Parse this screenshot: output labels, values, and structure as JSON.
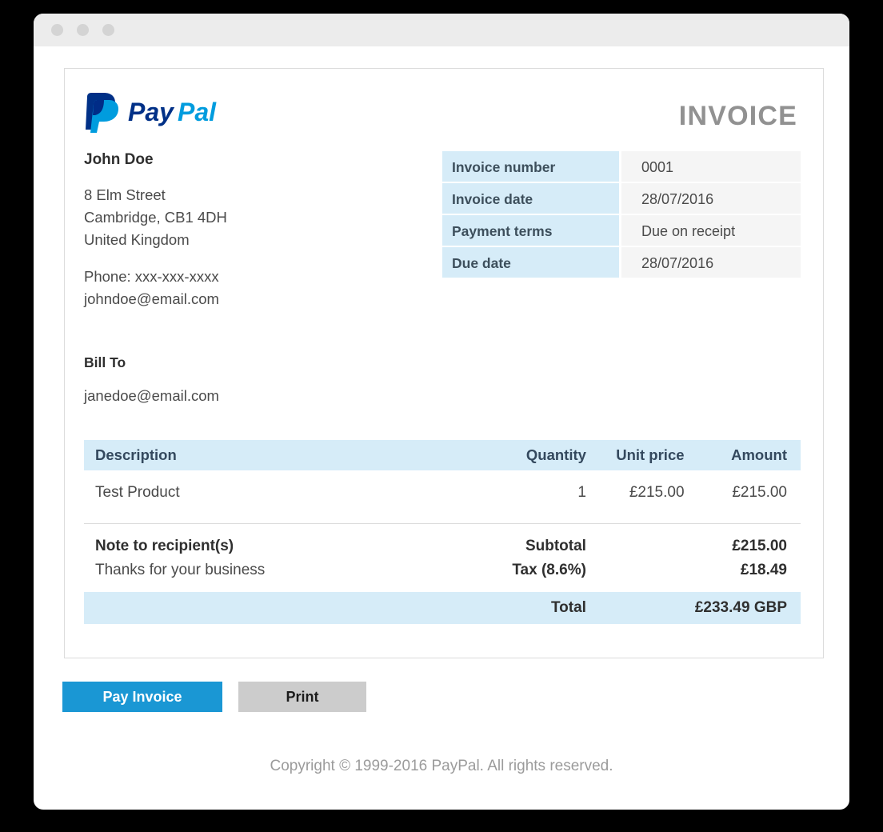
{
  "window": {
    "traffic_lights": [
      "close-dot",
      "minimize-dot",
      "maximize-dot"
    ]
  },
  "header": {
    "brand_name": "PayPal",
    "document_title": "INVOICE",
    "brand_colors": {
      "dark_blue": "#003087",
      "light_blue": "#009cde"
    }
  },
  "sender": {
    "name": "John Doe",
    "address_line1": "8 Elm Street",
    "address_line2": "Cambridge, CB1 4DH",
    "address_line3": "United Kingdom",
    "phone": "Phone: xxx-xxx-xxxx",
    "email": "johndoe@email.com"
  },
  "bill_to": {
    "label": "Bill To",
    "email": "janedoe@email.com"
  },
  "details": [
    {
      "label": "Invoice number",
      "value": "0001"
    },
    {
      "label": "Invoice date",
      "value": "28/07/2016"
    },
    {
      "label": "Payment terms",
      "value": "Due on receipt"
    },
    {
      "label": "Due date",
      "value": "28/07/2016"
    }
  ],
  "items_table": {
    "headers": {
      "description": "Description",
      "quantity": "Quantity",
      "unit_price": "Unit price",
      "amount": "Amount"
    },
    "rows": [
      {
        "description": "Test Product",
        "quantity": "1",
        "unit_price": "£215.00",
        "amount": "£215.00"
      }
    ]
  },
  "note": {
    "title": "Note to recipient(s)",
    "text": "Thanks for your business"
  },
  "totals": {
    "subtotal_label": "Subtotal",
    "subtotal_value": "£215.00",
    "tax_label": "Tax (8.6%)",
    "tax_value": "£18.49",
    "total_label": "Total",
    "total_value": "£233.49 GBP"
  },
  "actions": {
    "pay_label": "Pay Invoice",
    "print_label": "Print",
    "pay_color": "#1a97d4",
    "print_color": "#cccccc"
  },
  "footer": {
    "copyright": "Copyright © 1999-2016 PayPal. All rights reserved."
  }
}
